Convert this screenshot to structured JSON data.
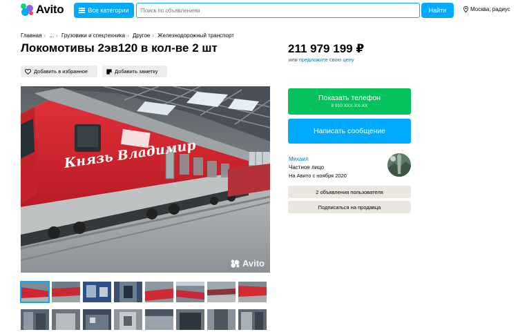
{
  "header": {
    "logo_text": "Avito",
    "categories_label": "Все категории",
    "search_placeholder": "Поиск по объявлениям",
    "find_label": "Найти",
    "location_label": "Москва, радиус"
  },
  "breadcrumb": [
    "Главная",
    "...",
    "Грузовики и спецтехника",
    "Другое",
    "Железнодорожный транспорт"
  ],
  "listing": {
    "title": "Локомотивы 2эв120 в кол-ве 2 шт",
    "price": "211 979 199 ₽",
    "price_sub_prefix": "или",
    "price_sub_link": "предложите свою цену",
    "favorite_label": "Добавить в избранное",
    "note_label": "Добавить заметку",
    "locomotive_text": "Князь Владимир",
    "watermark": "Avito"
  },
  "contact": {
    "phone_label": "Показать телефон",
    "phone_masked": "8 910 XXX-XX-XX",
    "message_label": "Написать сообщение"
  },
  "seller": {
    "name": "Михаил",
    "type": "Частное лицо",
    "since": "На Авито с ноября 2020",
    "ads_label": "2 объявления пользователя",
    "subscribe_label": "Подписаться на продавца"
  },
  "colors": {
    "accent_blue": "#00aaff",
    "phone_green": "#04c35c",
    "loco_red": "#d7262e"
  }
}
